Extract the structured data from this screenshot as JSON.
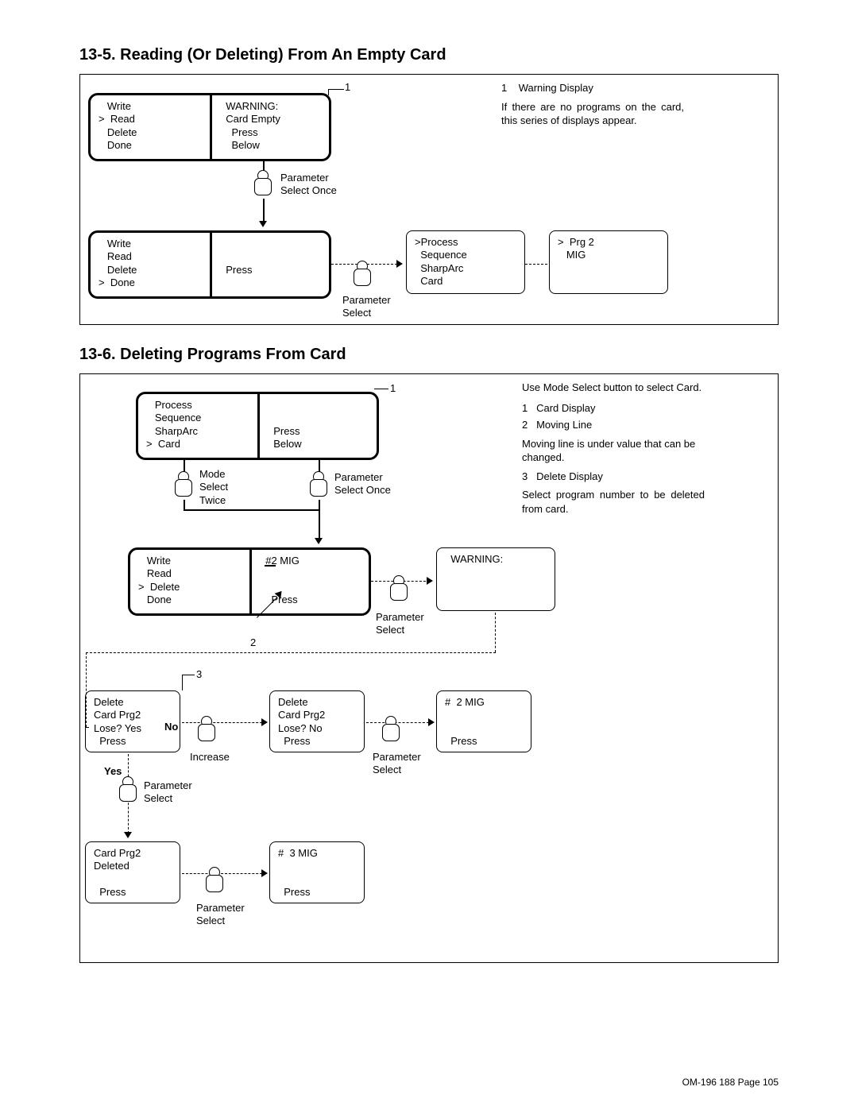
{
  "section1_title": "13-5. Reading (Or Deleting) From An Empty Card",
  "section2_title": "13-6. Deleting Programs From Card",
  "fig1": {
    "callout1": "1",
    "side1_num": "1",
    "side1_label": "Warning Display",
    "side_text": "If there are no programs on the card, this series of displays appear.",
    "pair1_left": "   Write\n>  Read\n   Delete\n   Done",
    "pair1_right": "  WARNING:\n  Card Empty\n    Press\n    Below",
    "action1": "Parameter\nSelect Once",
    "pair2_left": "   Write\n   Read\n   Delete\n>  Done",
    "pair2_right": "\n\n  Press",
    "action2": "Parameter\nSelect",
    "box3": ">Process\n  Sequence\n  SharpArc\n  Card",
    "box4": ">  Prg 2\n   MIG"
  },
  "fig2": {
    "callout1": "1",
    "callout2": "2",
    "callout3": "3",
    "side_intro": "Use Mode Select button to select Card.",
    "side1_num": "1",
    "side1_label": "Card Display",
    "side2_num": "2",
    "side2_label": "Moving Line",
    "side_mid": "Moving line is under value that can be changed.",
    "side3_num": "3",
    "side3_label": "Delete Display",
    "side_end": "Select program number to be deleted from card.",
    "pair1_left": "   Process\n   Sequence\n   SharpArc\n>  Card",
    "pair1_right": "\n\n  Press\n  Below",
    "actionA": "Mode\nSelect\nTwice",
    "actionB": "Parameter\nSelect Once",
    "pair2_left": "   Write\n   Read\n>  Delete\n   Done",
    "pair2_center": "  #2 MIG\n\n\n    Press",
    "pair2_right": "  WARNING:",
    "actionC": "Parameter\nSelect",
    "del1": "Delete\nCard Prg2\nLose? Yes\n  Press",
    "del2": "Delete\nCard Prg2\nLose? No\n  Press",
    "del3": "#  2 MIG\n\n\n  Press",
    "no_label": "No",
    "yes_label": "Yes",
    "actionD": "Increase",
    "actionE": "Parameter\nSelect",
    "actionF": "Parameter\nSelect",
    "del4": "Card Prg2\nDeleted\n\n  Press",
    "del5": "#  3 MIG\n\n\n  Press",
    "actionG": "Parameter\nSelect"
  },
  "footer": "OM-196 188 Page 105"
}
